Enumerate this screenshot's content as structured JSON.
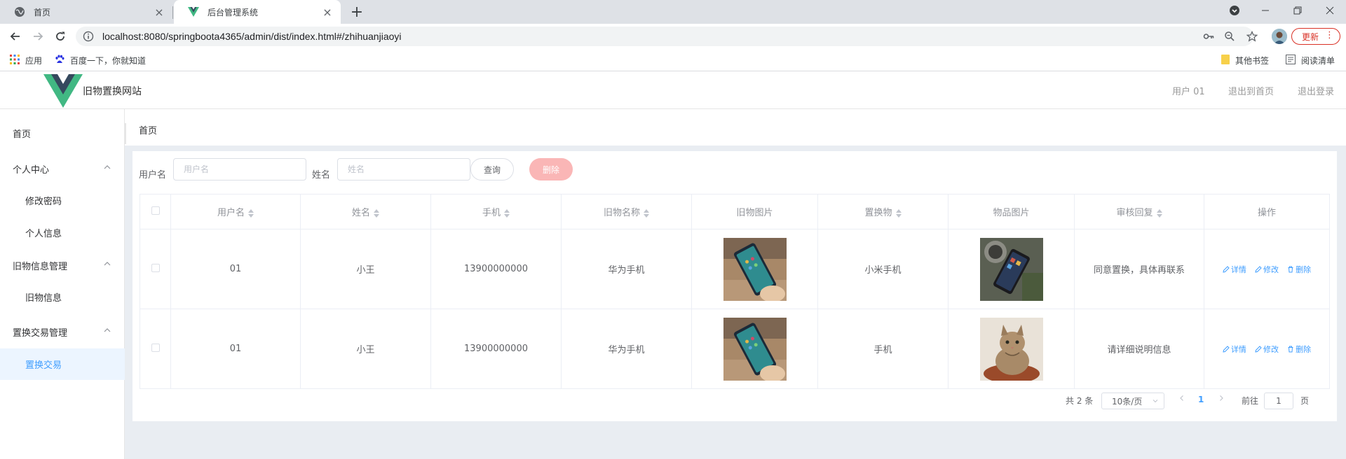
{
  "browser": {
    "tabs": [
      {
        "title": "首页",
        "icon": "globe-icon"
      },
      {
        "title": "后台管理系统",
        "icon": "vue-logo-icon"
      }
    ],
    "url": "localhost:8080/springboota4365/admin/dist/index.html#/zhihuanjiaoyi",
    "update_label": "更新",
    "bookmarks": [
      "应用",
      "百度一下，你就知道"
    ],
    "bookmarks_right": [
      "其他书签",
      "阅读清单"
    ]
  },
  "header": {
    "site_title": "旧物置换网站",
    "user": "用户 01",
    "back_home": "退出到首页",
    "logout": "退出登录"
  },
  "sidebar": {
    "items": [
      {
        "label": "首页",
        "level": "top"
      },
      {
        "label": "个人中心",
        "level": "group"
      },
      {
        "label": "修改密码",
        "level": "sub"
      },
      {
        "label": "个人信息",
        "level": "sub"
      },
      {
        "label": "旧物信息管理",
        "level": "group"
      },
      {
        "label": "旧物信息",
        "level": "sub"
      },
      {
        "label": "置换交易管理",
        "level": "group"
      },
      {
        "label": "置换交易",
        "level": "sub",
        "active": true
      }
    ]
  },
  "breadcrumb": "首页",
  "filters": {
    "username_label": "用户名",
    "username_placeholder": "用户名",
    "name_label": "姓名",
    "name_placeholder": "姓名",
    "query_label": "查询",
    "delete_label": "删除"
  },
  "table": {
    "columns": [
      "用户名",
      "姓名",
      "手机",
      "旧物名称",
      "旧物图片",
      "置换物",
      "物品图片",
      "审核回复",
      "操作"
    ],
    "rows": [
      {
        "username": "01",
        "name": "小王",
        "phone": "13900000000",
        "item_name": "华为手机",
        "exchange": "小米手机",
        "reply": "同意置换，具体再联系"
      },
      {
        "username": "01",
        "name": "小王",
        "phone": "13900000000",
        "item_name": "华为手机",
        "exchange": "手机",
        "reply": "请详细说明信息"
      }
    ],
    "actions": {
      "detail": "详情",
      "edit": "修改",
      "delete": "删除"
    }
  },
  "pagination": {
    "total": "共 2 条",
    "page_size": "10条/页",
    "current_page": "1",
    "goto_label": "前往",
    "goto_value": "1",
    "page_suffix": "页"
  },
  "colors": {
    "primary": "#409eff",
    "danger_light": "#fab6b6",
    "vue_green": "#41b883",
    "vue_dark": "#35495e"
  }
}
